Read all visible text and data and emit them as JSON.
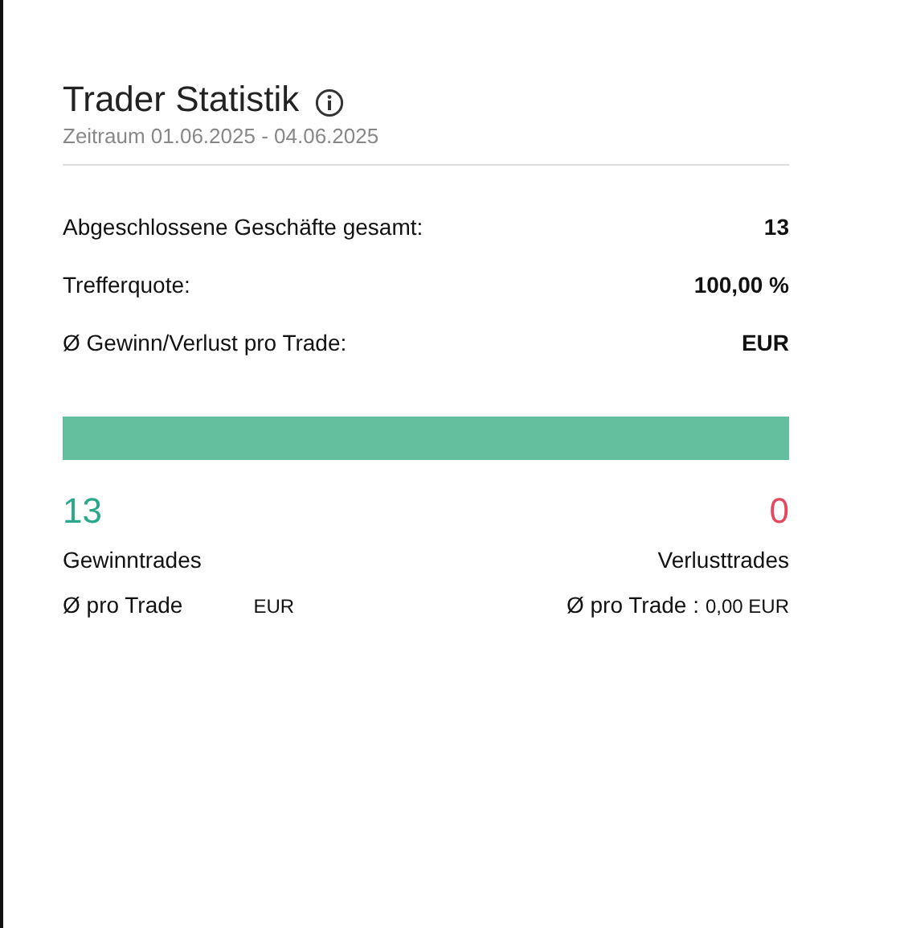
{
  "title": "Trader Statistik",
  "period": {
    "label": "Zeitraum",
    "from": "01.06.2025",
    "separator": "-",
    "to": "04.06.2025"
  },
  "stats": [
    {
      "label": "Abgeschlossene Geschäfte gesamt:",
      "value": "13"
    },
    {
      "label": "Trefferquote:",
      "value": "100,00 %"
    },
    {
      "label": "Ø Gewinn/Verlust pro Trade:",
      "value": "EUR"
    }
  ],
  "ratio_bar": {
    "level": 1
  },
  "winners": {
    "count": "13",
    "label": "Gewinntrades",
    "avg_label": "Ø pro Trade",
    "avg_value": "EUR"
  },
  "losers": {
    "count": "0",
    "label": "Verlusttrades",
    "avg_label": "Ø pro Trade :",
    "avg_value": "0,00 EUR"
  }
}
